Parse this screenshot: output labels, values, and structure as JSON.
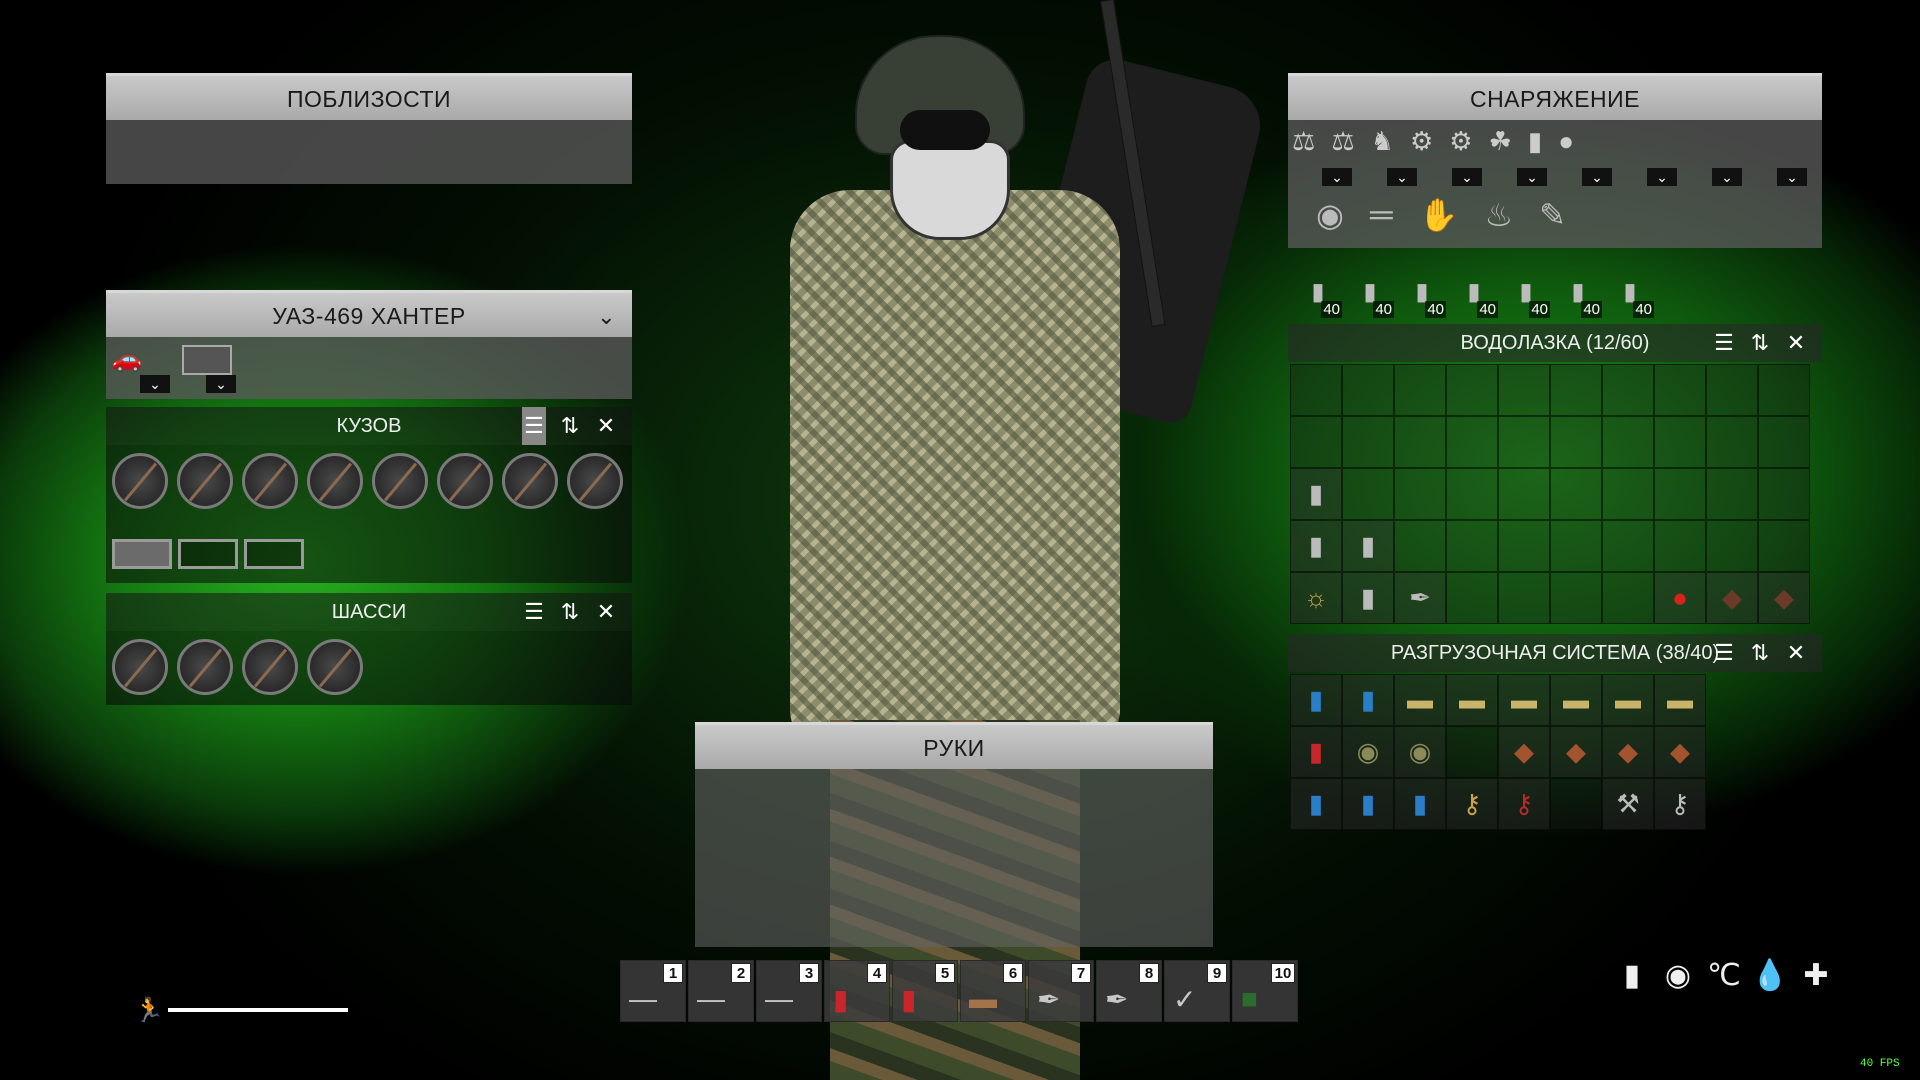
{
  "nearby": {
    "title": "ПОБЛИЗОСТИ"
  },
  "vehicle": {
    "title": "УАЗ-469 ХАНТЕР",
    "body": {
      "title": "КУЗОВ"
    },
    "chassis": {
      "title": "ШАССИ"
    }
  },
  "hands": {
    "title": "РУКИ"
  },
  "equipment": {
    "title": "СНАРЯЖЕНИЕ",
    "magazine_counts": [
      "40",
      "40",
      "40",
      "40",
      "40",
      "40",
      "40"
    ]
  },
  "turtleneck": {
    "title": "ВОДОЛАЗКА (12/60)"
  },
  "vest": {
    "title": "РАЗГРУЗОЧНАЯ СИСТЕМА (38/40)"
  },
  "hotbar": {
    "slots": [
      "1",
      "2",
      "3",
      "4",
      "5",
      "6",
      "7",
      "8",
      "9",
      "10"
    ]
  },
  "stamina": {
    "level": 1.0
  },
  "fps": "40 FPS",
  "icons": {
    "stats": [
      "water-bottle-icon",
      "food-icon",
      "temperature-icon",
      "blood-icon",
      "health-icon"
    ]
  }
}
